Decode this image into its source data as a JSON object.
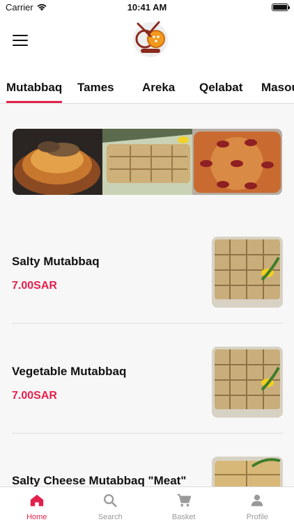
{
  "status": {
    "carrier": "Carrier",
    "time": "10:41 AM"
  },
  "header": {
    "menu_icon": "hamburger-icon",
    "logo": "restaurant-logo"
  },
  "tabs": [
    {
      "label": "Mutabbaq",
      "active": true
    },
    {
      "label": "Tames",
      "active": false
    },
    {
      "label": "Areka",
      "active": false
    },
    {
      "label": "Qelabat",
      "active": false
    },
    {
      "label": "Masou",
      "active": false
    }
  ],
  "items": [
    {
      "name": "Salty Mutabbaq",
      "price": "7.00SAR"
    },
    {
      "name": "Vegetable Mutabbaq",
      "price": "7.00SAR"
    },
    {
      "name": "Salty Cheese Mutabbaq \"Meat\"",
      "price": ""
    }
  ],
  "bottom_nav": [
    {
      "label": "Home",
      "icon": "home-icon",
      "active": true
    },
    {
      "label": "Search",
      "icon": "search-icon",
      "active": false
    },
    {
      "label": "Basket",
      "icon": "basket-icon",
      "active": false
    },
    {
      "label": "Profile",
      "icon": "profile-icon",
      "active": false
    }
  ],
  "colors": {
    "accent": "#e3204c",
    "inactive": "#999999",
    "text": "#111111"
  }
}
